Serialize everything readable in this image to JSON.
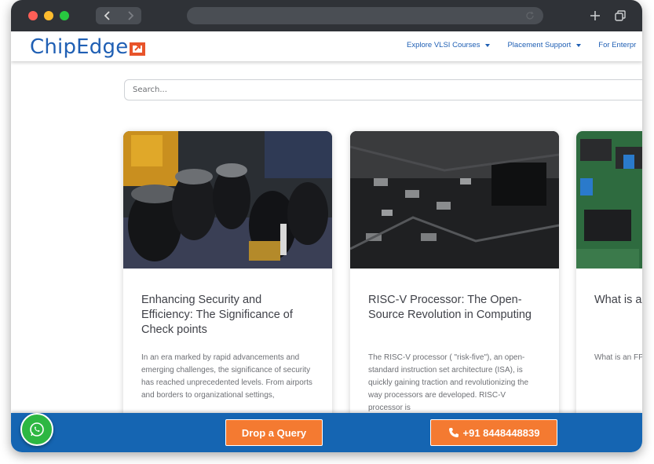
{
  "browser": {
    "back_icon": "chevron-left-icon",
    "forward_icon": "chevron-right-icon",
    "reload_icon": "reload-icon",
    "new_tab_icon": "plus-icon",
    "tabs_icon": "tabs-icon"
  },
  "header": {
    "logo_text": "ChipEdge",
    "nav": [
      {
        "label": "Explore VLSI Courses"
      },
      {
        "label": "Placement Support"
      },
      {
        "label": "For Enterpr"
      }
    ]
  },
  "search": {
    "placeholder": "Search..."
  },
  "cards": [
    {
      "title": "Enhancing Security and Efficiency: The Significance of Check points",
      "excerpt": "In an era marked by rapid advancements and emerging challenges, the significance of security has reached unprecedented levels. From airports and borders to organizational settings,"
    },
    {
      "title": "RISC-V Processor: The Open-Source Revolution in Computing",
      "excerpt": "The RISC-V processor ( \"risk-five\"), an open-standard instruction set architecture (ISA), is quickly gaining traction and revolutionizing the way processors are developed. RISC-V processor is"
    },
    {
      "title": "What is a",
      "excerpt": "What is an FP for 'Field Prog an integrated to"
    }
  ],
  "bottom_bar": {
    "query_label": "Drop a Query",
    "phone_label": "+91 8448448839",
    "whatsapp_icon": "whatsapp-icon",
    "phone_icon": "phone-icon"
  },
  "colors": {
    "brand_blue": "#1f5fb4",
    "bar_blue": "#1565b2",
    "cta_orange": "#f47a31",
    "whatsapp_green": "#2db742"
  }
}
